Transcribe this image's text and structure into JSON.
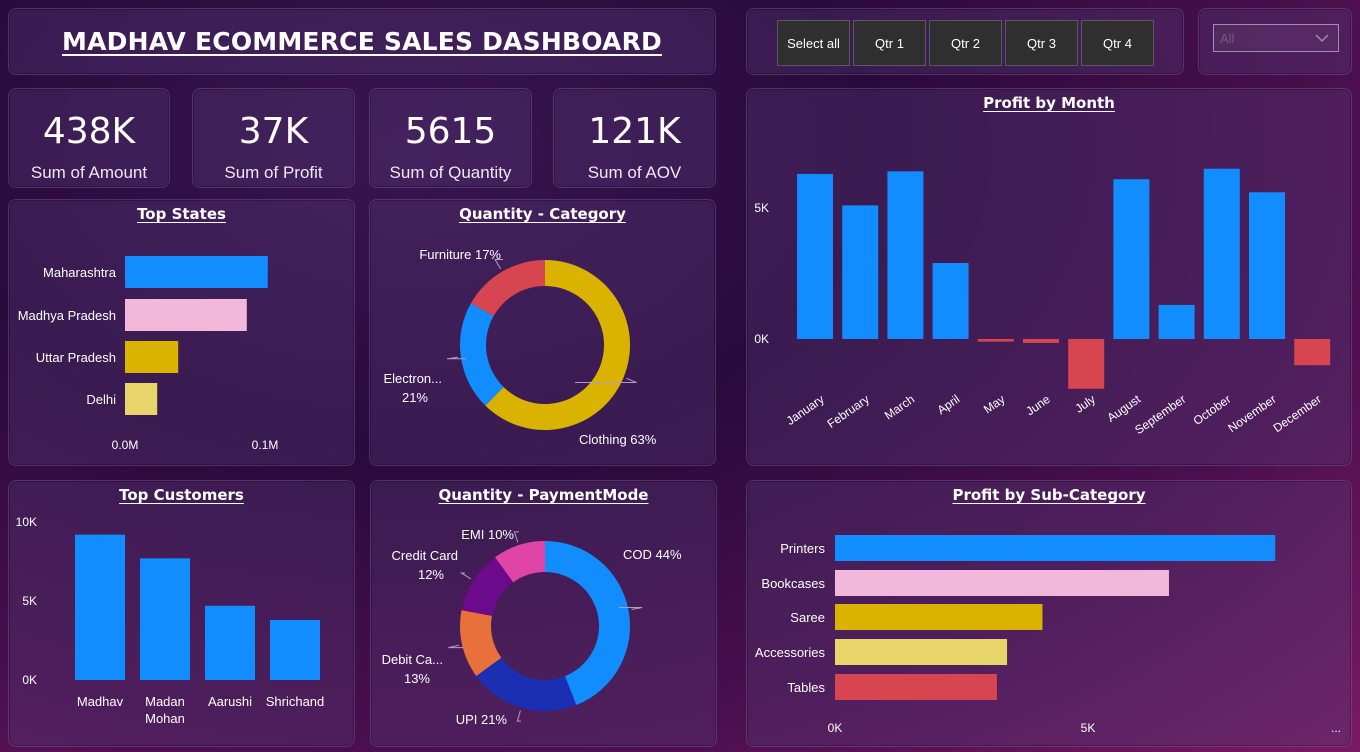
{
  "title": "MADHAV ECOMMERCE SALES DASHBOARD",
  "slicer": {
    "buttons": [
      "Select all",
      "Qtr 1",
      "Qtr 2",
      "Qtr 3",
      "Qtr 4"
    ]
  },
  "dropdown": {
    "value": "All",
    "icon": "chevron-down-icon"
  },
  "kpis": [
    {
      "value": "438K",
      "label": "Sum of Amount"
    },
    {
      "value": "37K",
      "label": "Sum of Profit"
    },
    {
      "value": "5615",
      "label": "Sum of Quantity"
    },
    {
      "value": "121K",
      "label": "Sum of AOV"
    }
  ],
  "chart_data": [
    {
      "id": "top_states",
      "type": "bar",
      "orientation": "horizontal",
      "title": "Top States",
      "categories": [
        "Maharashtra",
        "Madhya Pradesh",
        "Uttar Pradesh",
        "Delhi"
      ],
      "values": [
        0.102,
        0.087,
        0.038,
        0.023
      ],
      "colors": [
        "#118dff",
        "#f2b8dc",
        "#d9b300",
        "#e8d56a"
      ],
      "xticks": [
        "0.0M",
        "0.1M"
      ],
      "xlim": [
        0,
        0.1
      ]
    },
    {
      "id": "quantity_category",
      "type": "pie",
      "donut": true,
      "title": "Quantity - Category",
      "slices": [
        {
          "label": "Clothing",
          "pct_label": "Clothing 63%",
          "value": 63,
          "color": "#d9b300"
        },
        {
          "label": "Electronics",
          "pct_label": [
            "Electron...",
            "21%"
          ],
          "value": 21,
          "color": "#118dff"
        },
        {
          "label": "Furniture",
          "pct_label": "Furniture 17%",
          "value": 17,
          "color": "#d64550"
        }
      ]
    },
    {
      "id": "profit_by_month",
      "type": "bar",
      "title": "Profit by Month",
      "categories": [
        "January",
        "February",
        "March",
        "April",
        "May",
        "June",
        "July",
        "August",
        "September",
        "October",
        "November",
        "December"
      ],
      "values": [
        6300,
        5100,
        6400,
        2900,
        -100,
        -150,
        -1900,
        6100,
        1300,
        6500,
        5600,
        -1000
      ],
      "colors": [
        "#118dff",
        "#118dff",
        "#118dff",
        "#118dff",
        "#d64550",
        "#d64550",
        "#d64550",
        "#118dff",
        "#118dff",
        "#118dff",
        "#118dff",
        "#d64550"
      ],
      "yticks": [
        "0K",
        "5K"
      ],
      "ytick_values": [
        0,
        5000
      ],
      "ylim": [
        -2000,
        7000
      ]
    },
    {
      "id": "top_customers",
      "type": "bar",
      "title": "Top Customers",
      "categories": [
        "Madhav",
        "Madan Mohan",
        "Aarushi",
        "Shrichand"
      ],
      "category_lines": [
        [
          "Madhav"
        ],
        [
          "Madan",
          "Mohan"
        ],
        [
          "Aarushi"
        ],
        [
          "Shrichand"
        ]
      ],
      "values": [
        9200,
        7700,
        4700,
        3800
      ],
      "color": "#118dff",
      "yticks": [
        "0K",
        "5K",
        "10K"
      ],
      "ytick_values": [
        0,
        5000,
        10000
      ],
      "ylim": [
        0,
        10000
      ]
    },
    {
      "id": "quantity_paymentmode",
      "type": "pie",
      "donut": true,
      "title": "Quantity - PaymentMode",
      "slices": [
        {
          "label": "COD",
          "pct_label": "COD 44%",
          "value": 44,
          "color": "#118dff"
        },
        {
          "label": "UPI",
          "pct_label": "UPI 21%",
          "value": 21,
          "color": "#1a2fb3"
        },
        {
          "label": "Debit Card",
          "pct_label": [
            "Debit Ca...",
            "13%"
          ],
          "value": 13,
          "color": "#e8703a"
        },
        {
          "label": "Credit Card",
          "pct_label": [
            "Credit Card",
            "12%"
          ],
          "value": 12,
          "color": "#6b0a8a"
        },
        {
          "label": "EMI",
          "pct_label": "EMI 10%",
          "value": 10,
          "color": "#e044a7"
        }
      ]
    },
    {
      "id": "profit_by_subcategory",
      "type": "bar",
      "orientation": "horizontal",
      "title": "Profit by Sub-Category",
      "categories": [
        "Printers",
        "Bookcases",
        "Saree",
        "Accessories",
        "Tables"
      ],
      "values": [
        8700,
        6600,
        4100,
        3400,
        3200
      ],
      "colors": [
        "#118dff",
        "#f2b8dc",
        "#d9b300",
        "#e8d56a",
        "#d64550"
      ],
      "xticks": [
        "0K",
        "5K",
        "..."
      ],
      "xtick_values": [
        0,
        5000
      ],
      "xlim": [
        0,
        5000
      ]
    }
  ]
}
